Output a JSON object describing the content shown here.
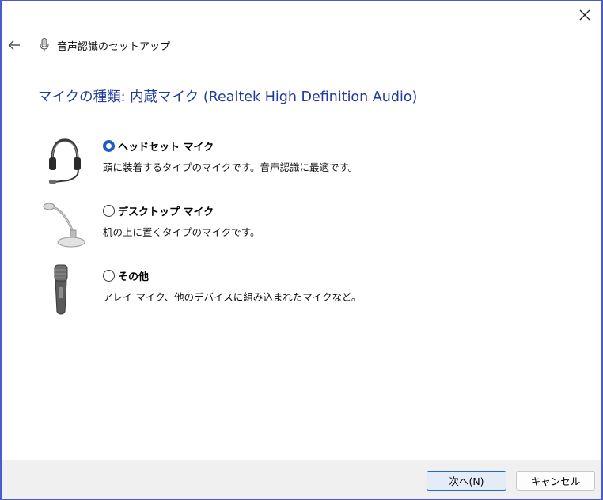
{
  "window": {
    "close_icon": "close-icon"
  },
  "nav": {
    "back_icon": "back-arrow-icon",
    "app_icon": "microphone-icon",
    "title": "音声認識のセットアップ"
  },
  "heading": "マイクの種類: 内蔵マイク (Realtek High Definition Audio)",
  "options": [
    {
      "label": "ヘッドセット マイク",
      "description": "頭に装着するタイプのマイクです。音声認識に最適です。",
      "selected": true,
      "icon": "headset-icon"
    },
    {
      "label": "デスクトップ マイク",
      "description": "机の上に置くタイプのマイクです。",
      "selected": false,
      "icon": "desktop-microphone-icon"
    },
    {
      "label": "その他",
      "description": "アレイ マイク、他のデバイスに組み込まれたマイクなど。",
      "selected": false,
      "icon": "handheld-microphone-icon"
    }
  ],
  "footer": {
    "next_label": "次へ(N)",
    "cancel_label": "キャンセル"
  },
  "colors": {
    "heading": "#1f3b9c",
    "accent": "#1c5fc4",
    "window_border": "#4a5bd0"
  }
}
